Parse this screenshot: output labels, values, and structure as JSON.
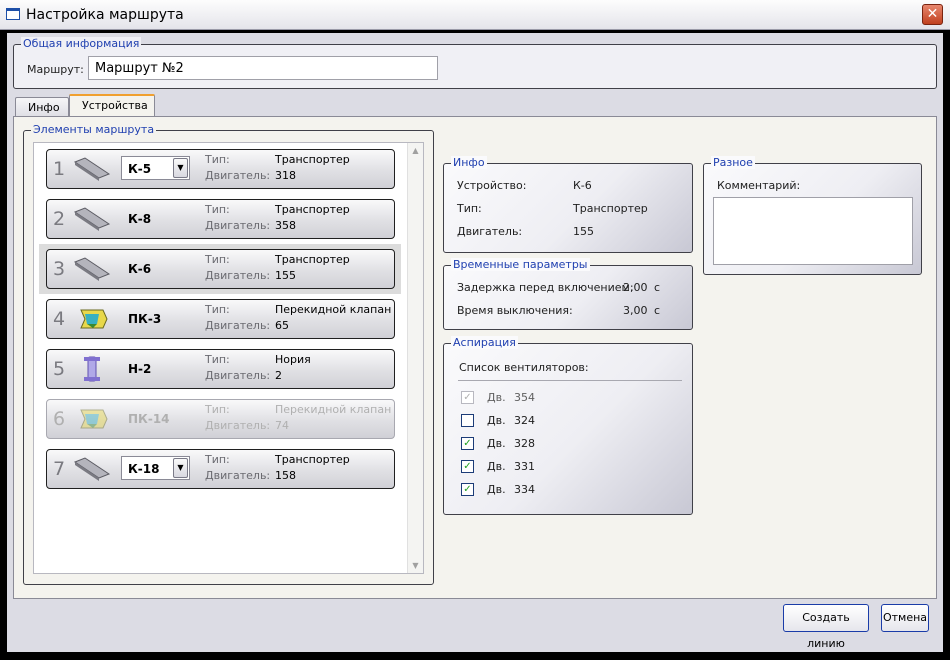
{
  "window": {
    "title": "Настройка маршрута"
  },
  "general": {
    "legend": "Общая информация",
    "route_label": "Маршрут:",
    "route_value": "Маршрут №2"
  },
  "tabs": [
    {
      "label": "Инфо"
    },
    {
      "label": "Устройства"
    }
  ],
  "elements": {
    "legend": "Элементы маршрута",
    "type_key": "Тип:",
    "engine_key": "Двигатель:",
    "items": [
      {
        "num": "1",
        "code": "К-5",
        "type": "Транспортер",
        "engine": "318",
        "icon": "conveyor-icon"
      },
      {
        "num": "2",
        "code": "К-8",
        "type": "Транспортер",
        "engine": "358",
        "icon": "conveyor-icon"
      },
      {
        "num": "3",
        "code": "К-6",
        "type": "Транспортер",
        "engine": "155",
        "icon": "conveyor-icon"
      },
      {
        "num": "4",
        "code": "ПК-3",
        "type": "Перекидной клапан",
        "engine": "65",
        "icon": "valve-icon"
      },
      {
        "num": "5",
        "code": "Н-2",
        "type": "Нория",
        "engine": "2",
        "icon": "elevator-icon"
      },
      {
        "num": "6",
        "code": "ПК-14",
        "type": "Перекидной клапан",
        "engine": "74",
        "icon": "valve-icon"
      },
      {
        "num": "7",
        "code": "К-18",
        "type": "Транспортер",
        "engine": "158",
        "icon": "conveyor-icon"
      }
    ]
  },
  "info": {
    "legend": "Инфо",
    "device_label": "Устройство:",
    "device": "К-6",
    "type_label": "Тип:",
    "type": "Транспортер",
    "engine_label": "Двигатель:",
    "engine": "155"
  },
  "timing": {
    "legend": "Временные параметры",
    "delay_label": "Задержка перед включением:",
    "delay": "2,00",
    "delay_unit": "с",
    "off_label": "Время выключения:",
    "off": "3,00",
    "off_unit": "с"
  },
  "aspiration": {
    "legend": "Аспирация",
    "list_label": "Список вентиляторов:",
    "fans": [
      {
        "label": "Дв.",
        "num": "354",
        "checked": true,
        "disabled": true
      },
      {
        "label": "Дв.",
        "num": "324",
        "checked": false,
        "disabled": false
      },
      {
        "label": "Дв.",
        "num": "328",
        "checked": true,
        "disabled": false
      },
      {
        "label": "Дв.",
        "num": "331",
        "checked": true,
        "disabled": false
      },
      {
        "label": "Дв.",
        "num": "334",
        "checked": true,
        "disabled": false
      }
    ]
  },
  "misc": {
    "legend": "Разное",
    "comment_label": "Комментарий:",
    "comment_value": ""
  },
  "buttons": {
    "create": "Создать линию",
    "cancel": "Отмена"
  },
  "colors": {
    "legend_text": "#2040b0",
    "check_mark": "#20a020",
    "tab_accent": "#f0a030",
    "close_button": "#c0401f"
  }
}
